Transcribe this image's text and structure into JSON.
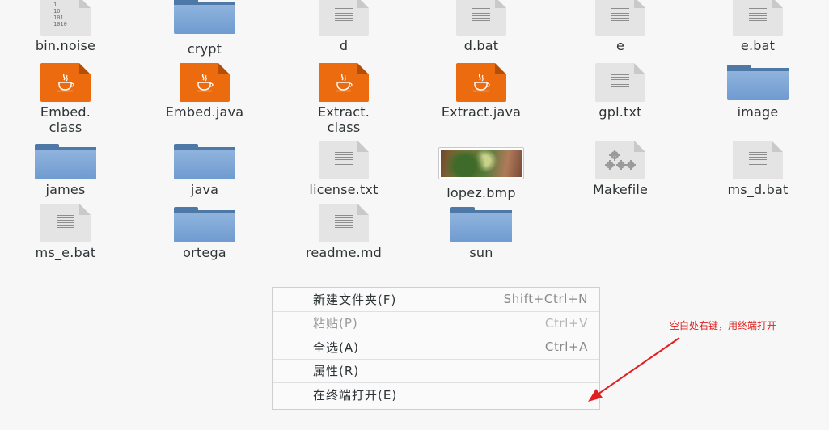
{
  "files": [
    {
      "name": "bin.noise",
      "icon": "binary-file-icon"
    },
    {
      "name": "crypt",
      "icon": "folder-icon"
    },
    {
      "name": "d",
      "icon": "text-file-icon"
    },
    {
      "name": "d.bat",
      "icon": "text-file-icon"
    },
    {
      "name": "e",
      "icon": "text-file-icon"
    },
    {
      "name": "e.bat",
      "icon": "text-file-icon"
    },
    {
      "name": "Embed.\nclass",
      "icon": "java-file-icon"
    },
    {
      "name": "Embed.java",
      "icon": "java-file-icon"
    },
    {
      "name": "Extract.\nclass",
      "icon": "java-file-icon"
    },
    {
      "name": "Extract.java",
      "icon": "java-file-icon"
    },
    {
      "name": "gpl.txt",
      "icon": "text-file-icon"
    },
    {
      "name": "image",
      "icon": "folder-icon"
    },
    {
      "name": "james",
      "icon": "folder-icon"
    },
    {
      "name": "java",
      "icon": "folder-icon"
    },
    {
      "name": "license.txt",
      "icon": "text-file-icon"
    },
    {
      "name": "lopez.bmp",
      "icon": "image-thumbnail-icon"
    },
    {
      "name": "Makefile",
      "icon": "makefile-gear-icon"
    },
    {
      "name": "ms_d.bat",
      "icon": "text-file-icon"
    },
    {
      "name": "ms_e.bat",
      "icon": "text-file-icon"
    },
    {
      "name": "ortega",
      "icon": "folder-icon"
    },
    {
      "name": "readme.md",
      "icon": "text-file-icon"
    },
    {
      "name": "sun",
      "icon": "folder-icon"
    }
  ],
  "binary_icon_text": "1\n10\n101\n1010",
  "context_menu": {
    "items": [
      {
        "label": "新建文件夹(F)",
        "shortcut": "Shift+Ctrl+N",
        "enabled": true
      },
      {
        "label": "粘贴(P)",
        "shortcut": "Ctrl+V",
        "enabled": false
      },
      {
        "label": "全选(A)",
        "shortcut": "Ctrl+A",
        "enabled": true
      },
      {
        "label": "属性(R)",
        "shortcut": "",
        "enabled": true
      },
      {
        "label": "在终端打开(E)",
        "shortcut": "",
        "enabled": true
      }
    ]
  },
  "annotation": {
    "text": "空白处右键，用终端打开",
    "color": "#e02020"
  },
  "colors": {
    "background": "#f7f7f7",
    "folder": "#6f9bd0",
    "java": "#ec6b0f",
    "doc": "#e4e4e4"
  }
}
